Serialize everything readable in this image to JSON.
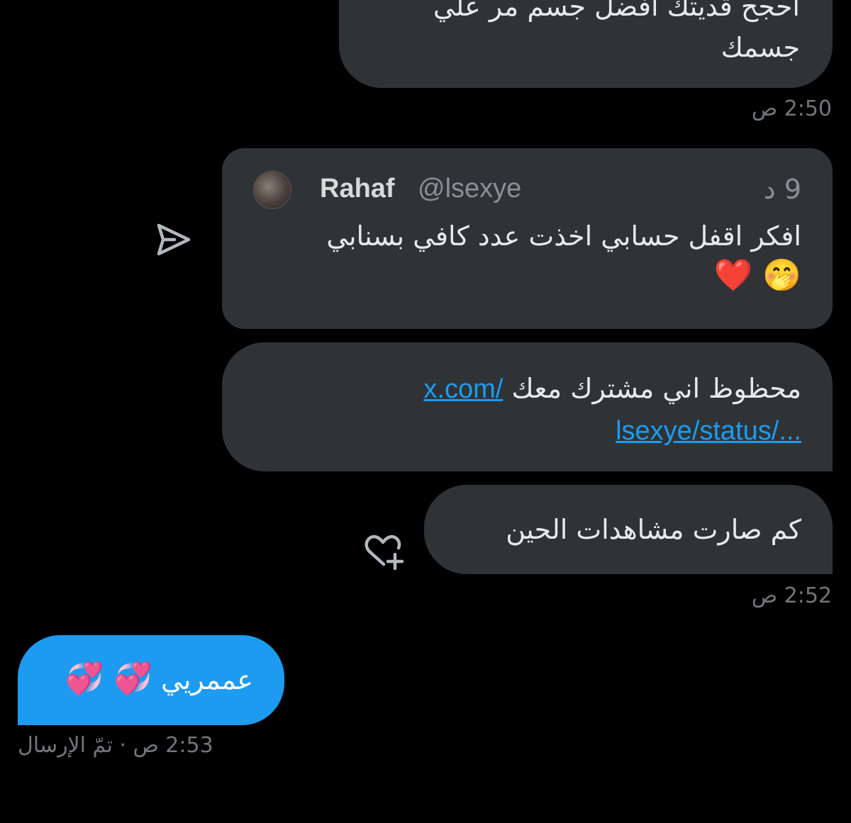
{
  "messages": {
    "received_1": {
      "line1": "احجح قديتك افضل جسم مر علي",
      "line2": "جسمك",
      "time": "2:50 ص"
    },
    "shared_tweet": {
      "name": "Rahaf",
      "handle": "@lsexye",
      "age": "9 د",
      "text": "افكر اقفل حسابي اخذت عدد كافي بسنابي",
      "emojis": "🤭 ❤️"
    },
    "link_message": {
      "text": "محظوظ اني مشترك معك",
      "link_line1": "x.com/",
      "link_line2": "lsexye/status/..."
    },
    "question": {
      "text": "كم صارت مشاهدات الحين",
      "time": "2:52 ص"
    },
    "sent": {
      "text": "عممريي",
      "emojis": "💞 💞",
      "status": "2:53 ص · تمّ الإرسال"
    }
  },
  "icons": {
    "share": "share-arrow-icon",
    "react": "heart-add-icon"
  },
  "colors": {
    "background": "#000000",
    "received_bubble": "#2f3336",
    "sent_bubble": "#1d9bf0",
    "link": "#1d9bf0",
    "muted_text": "#71767b"
  }
}
